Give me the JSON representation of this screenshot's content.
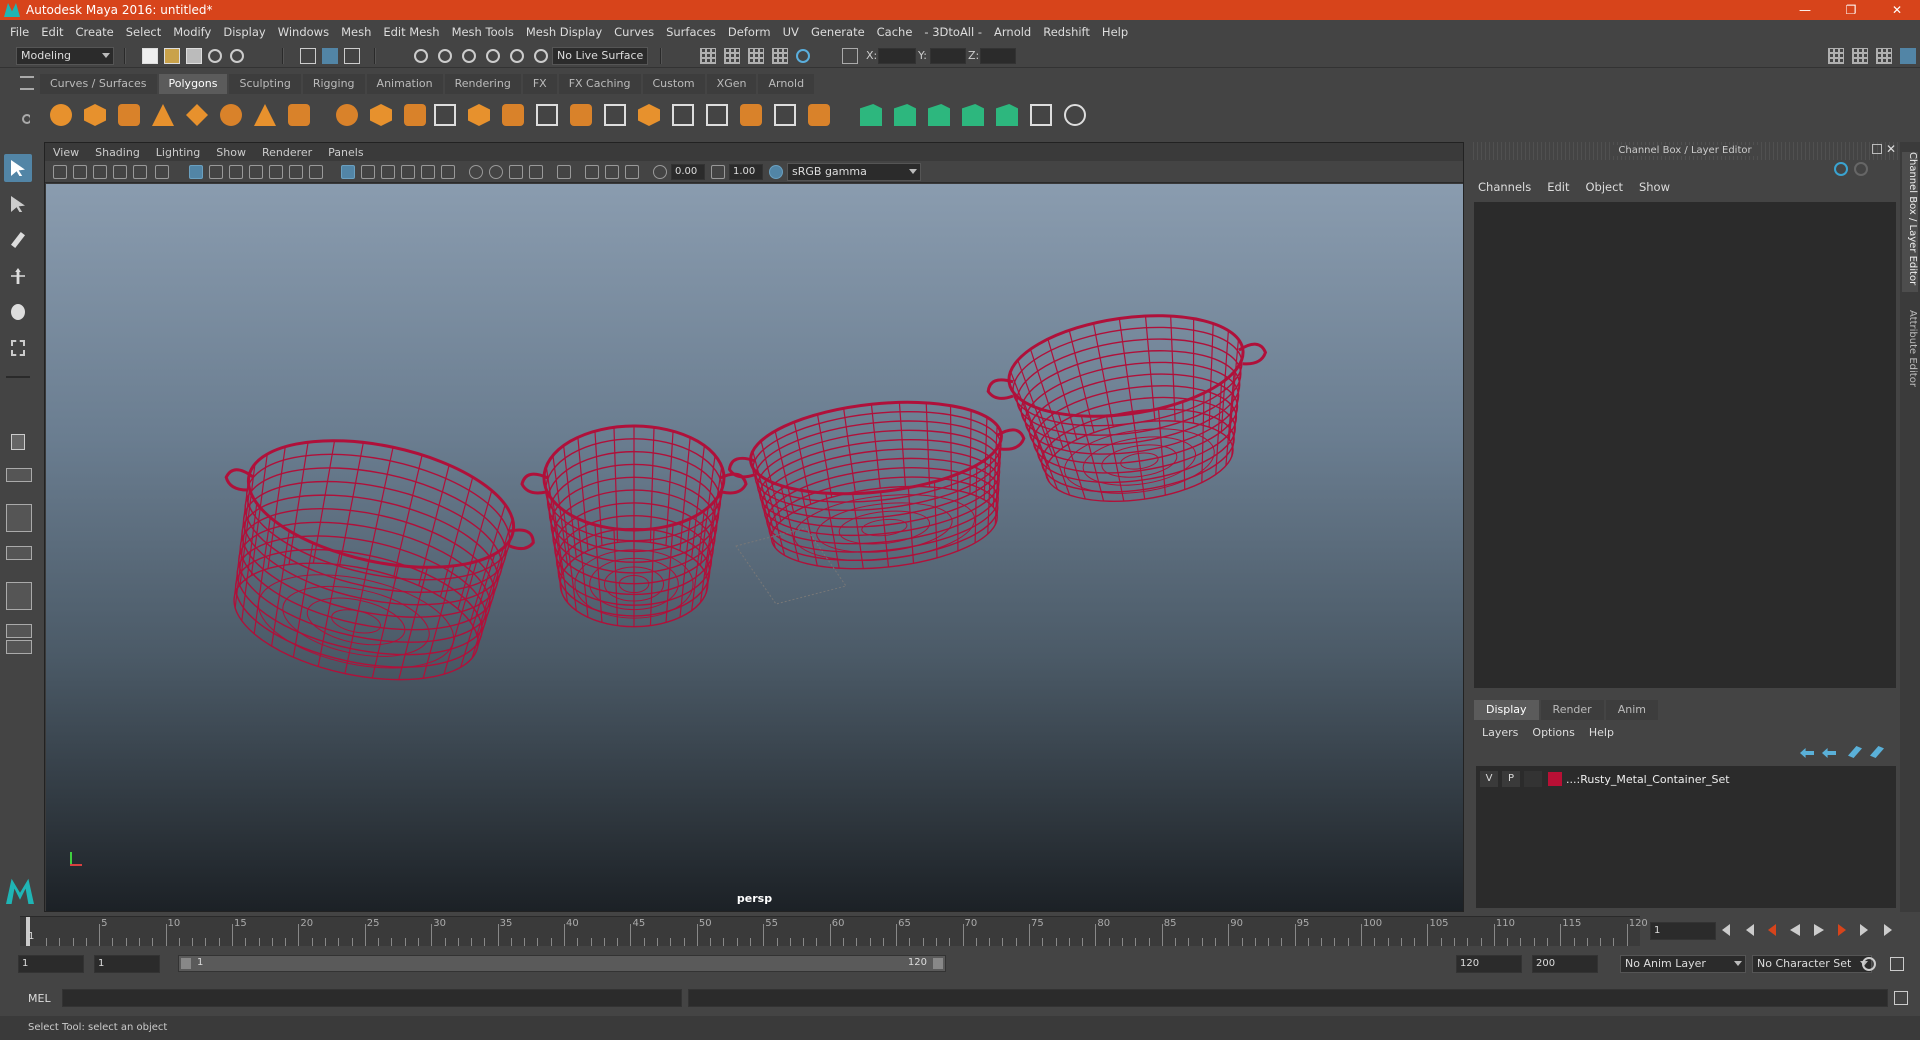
{
  "window": {
    "title": "Autodesk Maya 2016: untitled*",
    "controls": [
      "—",
      "❐",
      "✕"
    ]
  },
  "menubar": [
    "File",
    "Edit",
    "Create",
    "Select",
    "Modify",
    "Display",
    "Windows",
    "Mesh",
    "Edit Mesh",
    "Mesh Tools",
    "Mesh Display",
    "Curves",
    "Surfaces",
    "Deform",
    "UV",
    "Generate",
    "Cache",
    "- 3DtoAll -",
    "Arnold",
    "Redshift",
    "Help"
  ],
  "statusline": {
    "mode": "Modeling",
    "live_surface": "No Live Surface",
    "x_label": "X:",
    "y_label": "Y:",
    "z_label": "Z:"
  },
  "shelf_tabs": [
    "Curves / Surfaces",
    "Polygons",
    "Sculpting",
    "Rigging",
    "Animation",
    "Rendering",
    "FX",
    "FX Caching",
    "Custom",
    "XGen",
    "Arnold"
  ],
  "shelf_active": "Polygons",
  "viewport": {
    "menu": [
      "View",
      "Shading",
      "Lighting",
      "Show",
      "Renderer",
      "Panels"
    ],
    "exposure": "0.00",
    "gamma": "1.00",
    "color_space": "sRGB gamma",
    "camera": "persp",
    "wire_color": "#b0103a"
  },
  "right_panel": {
    "title": "Channel Box / Layer Editor",
    "menu": [
      "Channels",
      "Edit",
      "Object",
      "Show"
    ],
    "layer_tabs": [
      "Display",
      "Render",
      "Anim"
    ],
    "layer_menu": [
      "Layers",
      "Options",
      "Help"
    ],
    "layer": {
      "v": "V",
      "p": "P",
      "name": "...:Rusty_Metal_Container_Set",
      "color": "#b81035"
    },
    "side_tabs": [
      "Channel Box / Layer Editor",
      "Attribute Editor"
    ]
  },
  "timeline": {
    "current_frame": "1",
    "ticks": [
      "5",
      "10",
      "15",
      "20",
      "25",
      "30",
      "35",
      "40",
      "45",
      "50",
      "55",
      "60",
      "65",
      "70",
      "75",
      "80",
      "85",
      "90",
      "95",
      "100",
      "105",
      "110",
      "115",
      "120"
    ],
    "start_label": "1"
  },
  "range": {
    "start": "1",
    "start_inner": "1",
    "slider_start": "1",
    "slider_end": "120",
    "end_inner": "120",
    "end": "200",
    "anim_layer": "No Anim Layer",
    "char_set": "No Character Set"
  },
  "command": {
    "label": "MEL",
    "help": "Select Tool: select an object"
  }
}
